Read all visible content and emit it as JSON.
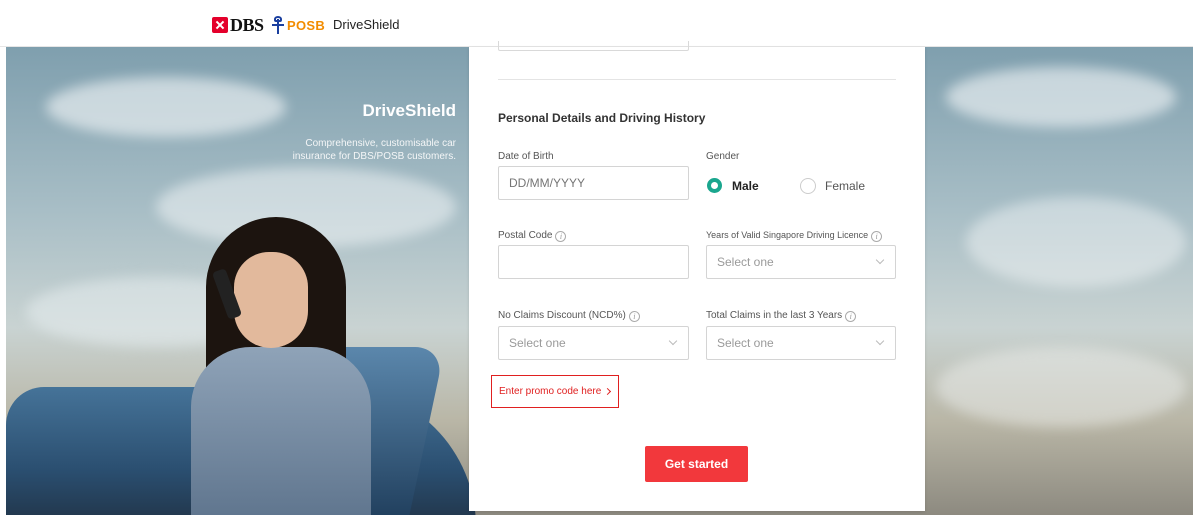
{
  "header": {
    "brand_dbs": "DBS",
    "brand_posb": "POSB",
    "product_name": "DriveShield"
  },
  "hero": {
    "title": "DriveShield",
    "subtitle": "Comprehensive, customisable car insurance for DBS/POSB customers."
  },
  "form": {
    "section_title": "Personal Details and Driving History",
    "dob": {
      "label": "Date of Birth",
      "placeholder": "DD/MM/YYYY"
    },
    "gender": {
      "label": "Gender",
      "options": [
        "Male",
        "Female"
      ],
      "selected": "Male"
    },
    "postal_code": {
      "label": "Postal Code",
      "value": ""
    },
    "licence_years": {
      "label": "Years of Valid Singapore Driving Licence",
      "value": "Select one"
    },
    "ncd": {
      "label": "No Claims Discount (NCD%)",
      "value": "Select one"
    },
    "total_claims": {
      "label": "Total Claims in the last 3 Years",
      "value": "Select one"
    },
    "promo_link": "Enter promo code here",
    "submit_label": "Get started"
  },
  "colors": {
    "accent_red": "#f2383c",
    "radio_selected": "#1aa68e",
    "posb_orange": "#f28c00",
    "dbs_red": "#e4002b"
  },
  "icons": [
    "dbs-logo-icon",
    "posb-logo-icon",
    "info-icon",
    "chevron-down-icon",
    "chevron-right-icon"
  ]
}
